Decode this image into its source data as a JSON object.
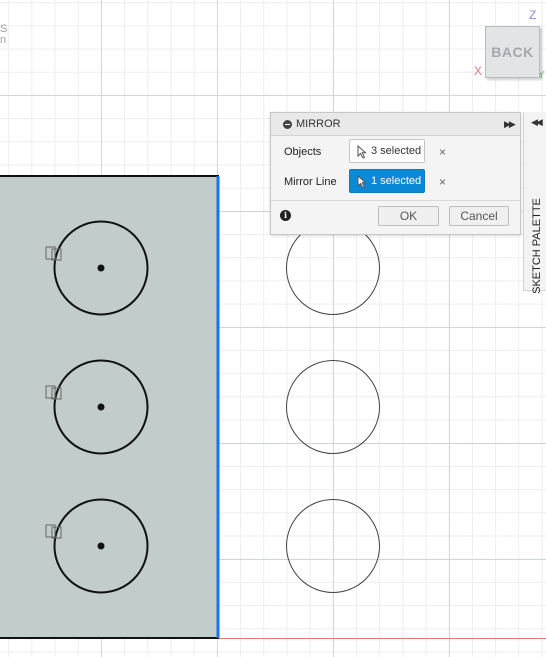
{
  "viewcube": {
    "face_label": "BACK",
    "axes": {
      "z": "Z",
      "x": "X",
      "y": "Y"
    }
  },
  "corner_text": [
    "S",
    "n"
  ],
  "mirror_dialog": {
    "title": "MIRROR",
    "objects_label": "Objects",
    "objects_value": "3 selected",
    "mirror_line_label": "Mirror Line",
    "mirror_line_value": "1 selected",
    "clear_symbol": "×",
    "ok_label": "OK",
    "cancel_label": "Cancel"
  },
  "sketch_palette": {
    "label": "SKETCH PALETTE"
  },
  "colors": {
    "profile_fill": "#c2cccb",
    "mirror_line": "#1a73e8",
    "selection_blue": "#0a8ad6",
    "x_axis": "#e07b7b"
  }
}
